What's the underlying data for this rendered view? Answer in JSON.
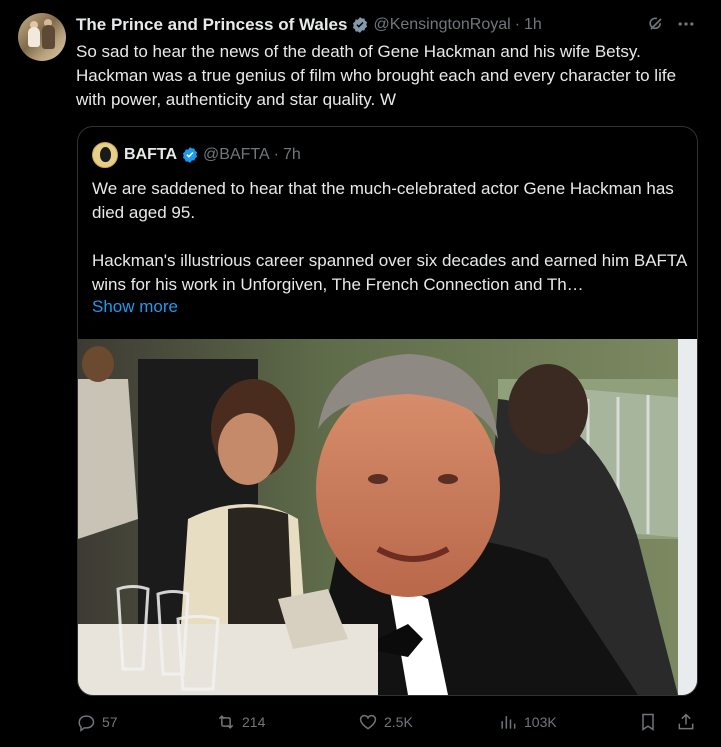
{
  "tweet": {
    "author_name": "The Prince and Princess of Wales",
    "handle": "@KensingtonRoyal",
    "separator": "·",
    "time": "1h",
    "text": "So sad to hear the news of the death of Gene Hackman and his wife Betsy. Hackman was a true genius of film who brought each and every character to life with power, authenticity and star quality. W"
  },
  "quote": {
    "author_name": "BAFTA",
    "handle": "@BAFTA",
    "separator": "·",
    "time": "7h",
    "paragraph1": "We are saddened to hear that the much-celebrated actor Gene Hackman has died aged 95.",
    "paragraph2": "Hackman's illustrious career spanned over six decades and earned him BAFTA wins for his work in Unforgiven, The French Connection and Th…",
    "show_more": "Show more"
  },
  "actions": {
    "replies": "57",
    "reposts": "214",
    "likes": "2.5K",
    "views": "103K"
  },
  "colors": {
    "background": "#000000",
    "text": "#e7e9ea",
    "muted": "#71767b",
    "accent": "#1d9bf0",
    "border": "#2f3336"
  },
  "icons": [
    "verified-badge-icon",
    "grok-icon",
    "more-icon",
    "reply-icon",
    "repost-icon",
    "like-icon",
    "views-icon",
    "bookmark-icon",
    "share-icon"
  ]
}
